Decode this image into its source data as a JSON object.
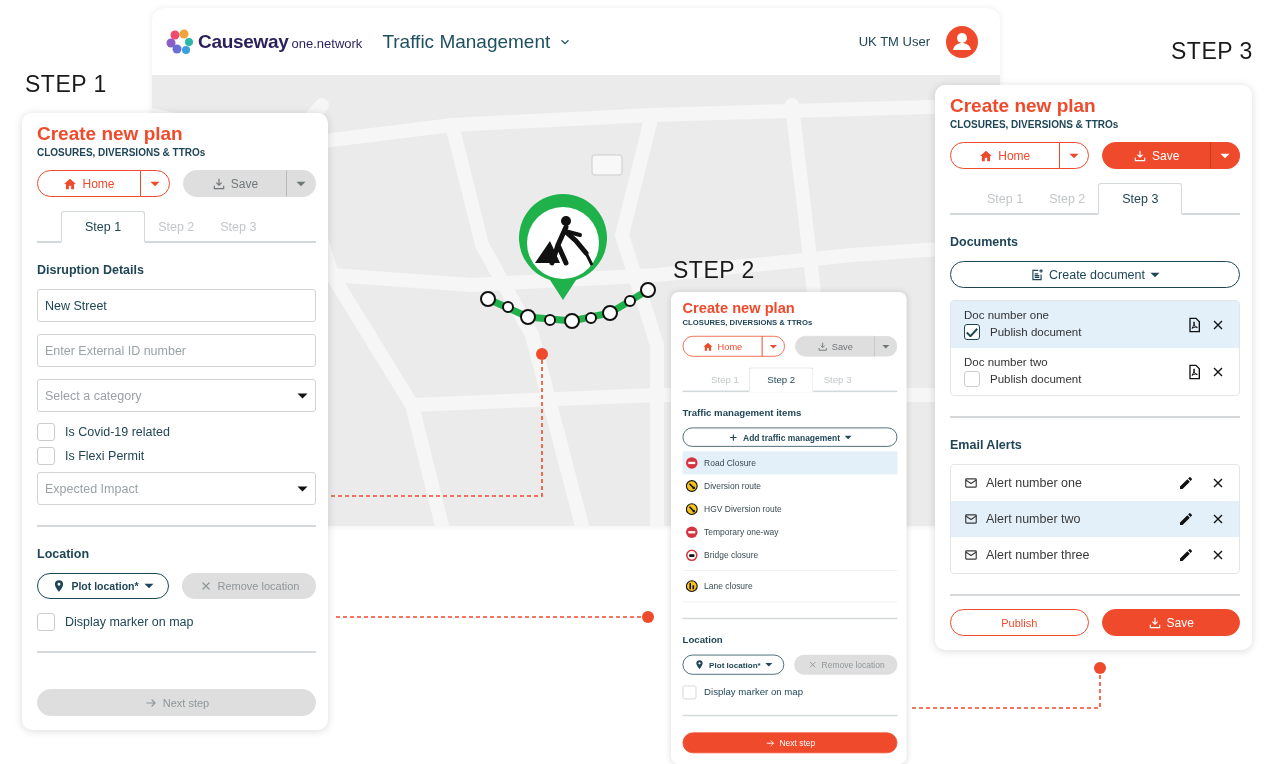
{
  "app_window": {
    "brand": "Causeway",
    "brand_suffix": "one.network",
    "module": "Traffic Management",
    "user": "UK TM User"
  },
  "panels": [
    {
      "caption": "STEP 1",
      "title": "Create new plan",
      "subtitle": "CLOSURES, DIVERSIONS & TTROs",
      "home_button": "Home",
      "save_button": {
        "label": "Save",
        "disabled": true
      },
      "tabs": [
        {
          "label": "Step 1",
          "selected": true
        },
        {
          "label": "Step 2",
          "selected": false
        },
        {
          "label": "Step 3",
          "selected": false
        }
      ],
      "sections": [
        {
          "kind": "form",
          "heading": "Disruption Details",
          "fields": [
            {
              "kind": "text",
              "value": "New Street"
            },
            {
              "kind": "text",
              "placeholder": "Enter External ID number"
            },
            {
              "kind": "select",
              "placeholder": "Select a category"
            },
            {
              "kind": "checkbox",
              "label": "Is Covid-19 related",
              "checked": false
            },
            {
              "kind": "checkbox",
              "label": "Is Flexi Permit",
              "checked": false
            },
            {
              "kind": "select",
              "placeholder": "Expected Impact"
            }
          ]
        },
        {
          "kind": "location",
          "heading": "Location",
          "plot_button": "Plot location*",
          "remove_button": "Remove location",
          "marker_checkbox": {
            "label": "Display marker on map",
            "checked": false
          }
        }
      ],
      "footer": [
        {
          "kind": "next",
          "label": "Next step",
          "disabled": true
        }
      ]
    },
    {
      "caption": "STEP 2",
      "title": "Create new plan",
      "subtitle": "CLOSURES, DIVERSIONS & TTROs",
      "home_button": "Home",
      "save_button": {
        "label": "Save",
        "disabled": true
      },
      "tabs": [
        {
          "label": "Step 1",
          "selected": false
        },
        {
          "label": "Step 2",
          "selected": true
        },
        {
          "label": "Step 3",
          "selected": false
        }
      ],
      "sections": [
        {
          "kind": "tm_items",
          "heading": "Traffic management items",
          "add_button": "Add traffic management",
          "items": [
            {
              "kind": "no-entry",
              "label": "Road Closure",
              "selected": true
            },
            {
              "kind": "diversion",
              "label": "Diversion route",
              "selected": false
            },
            {
              "kind": "diversion",
              "label": "HGV Diversion route",
              "selected": false
            },
            {
              "kind": "no-entry",
              "label": "Temporary one-way",
              "selected": false
            },
            {
              "kind": "no-vehicle",
              "label": "Bridge closure",
              "selected": false
            },
            {
              "kind": "lane",
              "label": "Lane closure",
              "selected": false
            }
          ]
        },
        {
          "kind": "location",
          "heading": "Location",
          "plot_button": "Plot location*",
          "remove_button": "Remove location",
          "marker_checkbox": {
            "label": "Display marker on map",
            "checked": false
          }
        }
      ],
      "footer": [
        {
          "kind": "next",
          "label": "Next step",
          "disabled": false
        }
      ]
    },
    {
      "caption": "STEP 3",
      "title": "Create new plan",
      "subtitle": "CLOSURES, DIVERSIONS & TTROs",
      "home_button": "Home",
      "save_button": {
        "label": "Save",
        "disabled": false
      },
      "tabs": [
        {
          "label": "Step 1",
          "selected": false
        },
        {
          "label": "Step 2",
          "selected": false
        },
        {
          "label": "Step 3",
          "selected": true
        }
      ],
      "sections": [
        {
          "kind": "documents",
          "heading": "Documents",
          "create_button": "Create document",
          "documents": [
            {
              "name": "Doc number one",
              "publish_label": "Publish document",
              "checked": true,
              "selected": true
            },
            {
              "name": "Doc number two",
              "publish_label": "Publish document",
              "checked": false,
              "selected": false
            }
          ]
        },
        {
          "kind": "alerts",
          "heading": "Email Alerts",
          "alerts": [
            {
              "label": "Alert number one",
              "selected": false
            },
            {
              "label": "Alert number two",
              "selected": true
            },
            {
              "label": "Alert number three",
              "selected": false
            }
          ]
        }
      ],
      "footer": [
        {
          "kind": "outline",
          "label": "Publish",
          "disabled": false
        },
        {
          "kind": "primary",
          "label": "Save",
          "disabled": false
        }
      ]
    }
  ]
}
